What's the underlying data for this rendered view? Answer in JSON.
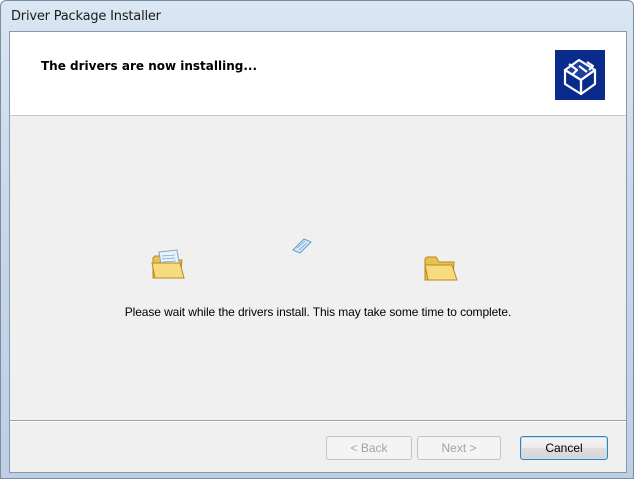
{
  "window": {
    "title": "Driver Package Installer"
  },
  "header": {
    "title": "The drivers are now installing...",
    "icon": "installer-box-icon"
  },
  "body": {
    "message": "Please wait while the drivers install. This may take some time to complete."
  },
  "buttons": {
    "back_label": "< Back",
    "next_label": "Next >",
    "cancel_label": "Cancel"
  },
  "colors": {
    "icon_bg": "#0a2a8c",
    "folder": "#f4d46a"
  }
}
